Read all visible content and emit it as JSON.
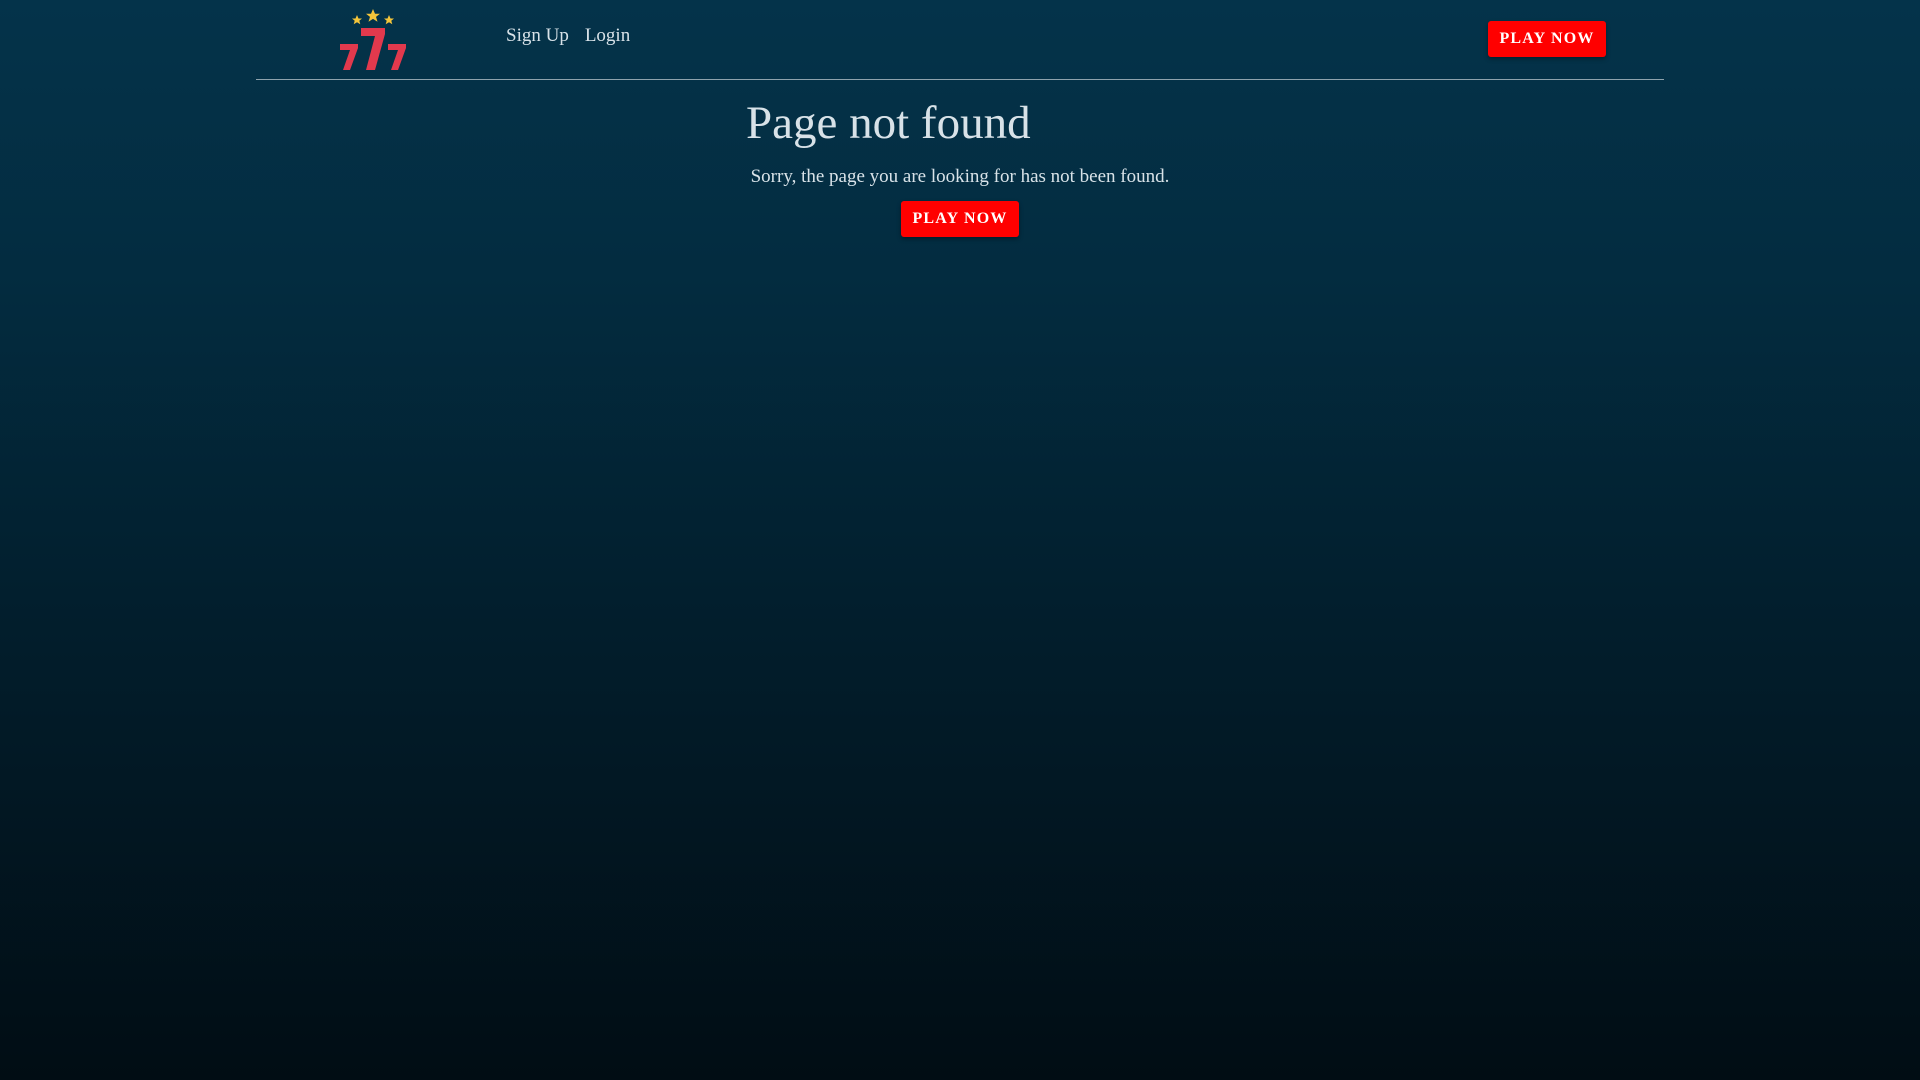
{
  "header": {
    "logo_icon": "seven-seven-seven-stars-logo",
    "nav": {
      "signup_label": "Sign Up",
      "login_label": "Login"
    },
    "play_now_label": "PLAY NOW"
  },
  "main": {
    "title": "Page not found",
    "message": "Sorry, the page you are looking for has not been found.",
    "play_now_label": "PLAY NOW"
  },
  "colors": {
    "accent": "#ff0000",
    "logo_red": "#e2394d",
    "star_gold": "#f5c53a",
    "background_top": "#04334a",
    "background_bottom": "#010d14"
  }
}
